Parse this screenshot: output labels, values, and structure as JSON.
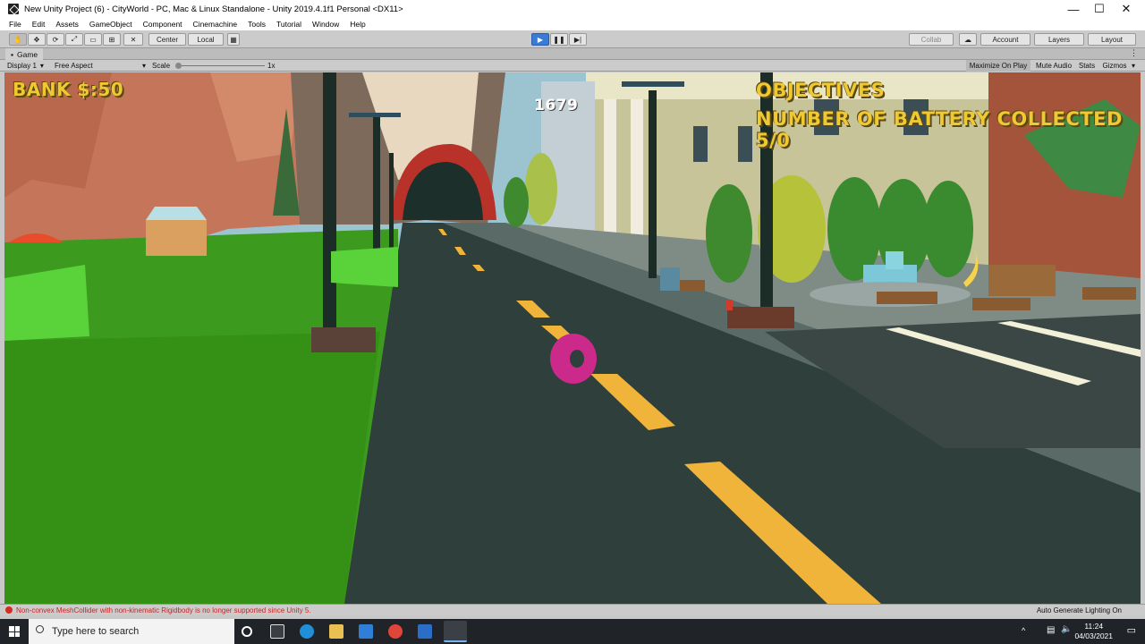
{
  "window": {
    "title": "New Unity Project (6) - CityWorld - PC, Mac & Linux Standalone - Unity 2019.4.1f1 Personal <DX11>",
    "minimize_glyph": "—",
    "maximize_glyph": "☐",
    "close_glyph": "✕"
  },
  "menu": [
    "File",
    "Edit",
    "Assets",
    "GameObject",
    "Component",
    "Cinemachine",
    "Tools",
    "Tutorial",
    "Window",
    "Help"
  ],
  "toolbar": {
    "pivot_label": "Center",
    "space_label": "Local",
    "collab_label": "Collab",
    "account_label": "Account",
    "layers_label": "Layers",
    "layout_label": "Layout"
  },
  "tab": {
    "label": "Game"
  },
  "gamebar": {
    "display": "Display 1",
    "aspect": "Free Aspect",
    "scale_label": "Scale",
    "scale_value": "1x",
    "maximize": "Maximize On Play",
    "mute": "Mute Audio",
    "stats": "Stats",
    "gizmos": "Gizmos"
  },
  "hud": {
    "bank": "BANK $:50",
    "counter": "1679",
    "objectives_title": "OBJECTIVES",
    "objectives_text": "NUMBER OF BATTERY COLLECTED 5/0"
  },
  "status": {
    "error": "Non-convex MeshCollider with non-kinematic Rigidbody is no longer supported since Unity 5.",
    "right": "Auto Generate Lighting On"
  },
  "taskbar": {
    "search_placeholder": "Type here to search",
    "time": "11:24",
    "date": "04/03/2021"
  },
  "colors": {
    "hud_text": "#f0c832",
    "play_button": "#3a7bd5",
    "road": "#2f3f3c",
    "grass": "#3c9a1e"
  }
}
